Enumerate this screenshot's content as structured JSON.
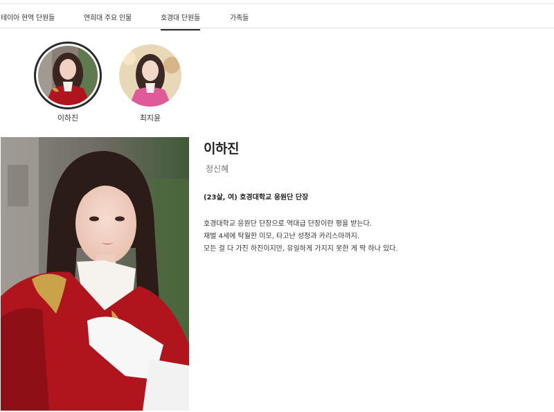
{
  "tabs": [
    {
      "label": "테이아 현역 단원들",
      "active": false
    },
    {
      "label": "연희대 주요 인물",
      "active": false
    },
    {
      "label": "호경대 단원들",
      "active": true
    },
    {
      "label": "가족들",
      "active": false
    }
  ],
  "characters": [
    {
      "name": "이하진",
      "selected": true
    },
    {
      "name": "최지윤",
      "selected": false
    }
  ],
  "detail": {
    "name": "이하진",
    "actor": "정신혜",
    "meta": "(23살, 여) 호경대학교 응원단 단장",
    "description": [
      "호경대학교 응원단 단장으로 역대급 단장이란 평을 받는다.",
      "재벌 4세에 탁월한 미모, 타고난 성정과 카리스마까지.",
      "모든 걸 다 가진 하진이지만, 유일하게 가지지 못한 게 딱 하나 있다."
    ]
  },
  "colors": {
    "active_underline": "#222222",
    "costume_red": "#b0141c",
    "gold_trim": "#c9a24a"
  }
}
